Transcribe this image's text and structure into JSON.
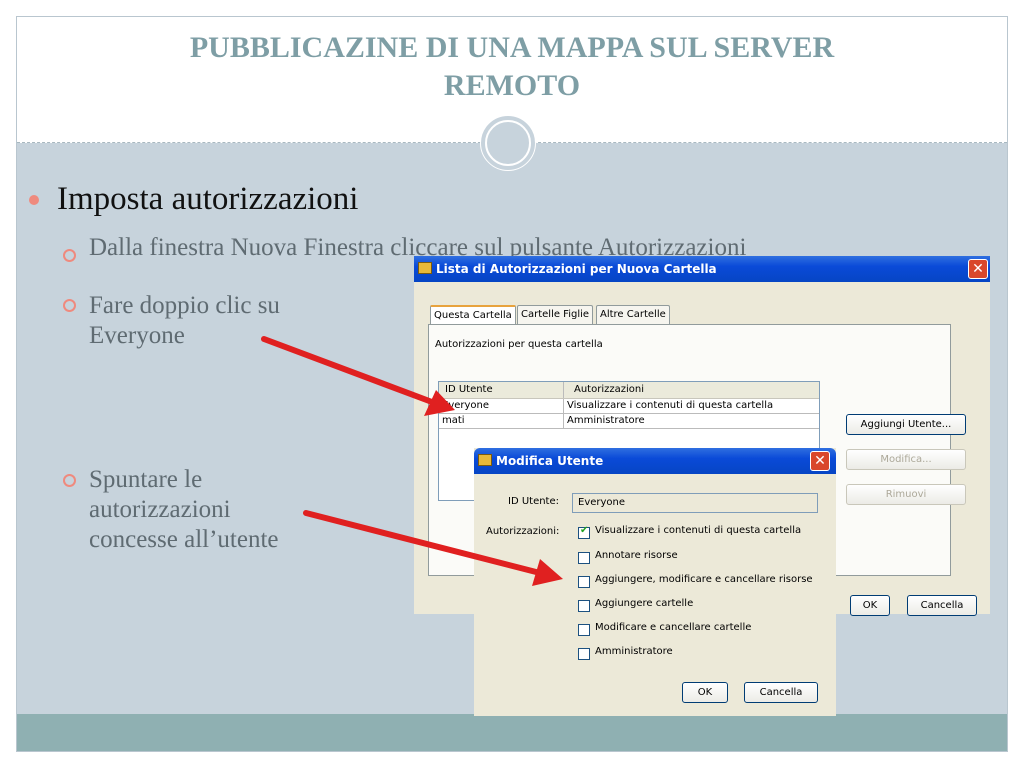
{
  "slide": {
    "title_line1": "PUBBLICAZINE DI UNA MAPPA  SUL SERVER",
    "title_line2": "REMOTO",
    "bullet_main": "Imposta autorizzazioni",
    "sub1": "Dalla finestra Nuova Finestra cliccare sul pulsante Autorizzazioni",
    "sub2_line1": "Fare doppio clic su",
    "sub2_line2": "Everyone",
    "sub3_line1": "Spuntare le",
    "sub3_line2": "autorizzazioni",
    "sub3_line3": "concesse  all’utente",
    "accent_color": "#ef8a7e",
    "title_color": "#7e9ea5"
  },
  "main_dialog": {
    "title": "Lista di Autorizzazioni per Nuova Cartella",
    "close_label": "✕",
    "tabs": [
      "Questa Cartella",
      "Cartelle Figlie",
      "Altre Cartelle"
    ],
    "section_label": "Autorizzazioni per questa cartella",
    "columns": [
      "ID Utente",
      "Autorizzazioni"
    ],
    "rows": [
      {
        "user": "Everyone",
        "perm": "Visualizzare i contenuti di questa cartella"
      },
      {
        "user": "mati",
        "perm": "Amministratore"
      }
    ],
    "add_user": "Aggiungi Utente...",
    "modify": "Modifica...",
    "remove": "Rimuovi",
    "ok": "OK",
    "cancel": "Cancella"
  },
  "edit_dialog": {
    "title": "Modifica Utente",
    "close_label": "✕",
    "id_label": "ID Utente:",
    "id_value": "Everyone",
    "perm_label": "Autorizzazioni:",
    "permissions": [
      {
        "label": "Visualizzare i contenuti di questa cartella",
        "checked": true
      },
      {
        "label": "Annotare risorse",
        "checked": false
      },
      {
        "label": "Aggiungere, modificare e cancellare risorse",
        "checked": false
      },
      {
        "label": "Aggiungere cartelle",
        "checked": false
      },
      {
        "label": "Modificare e cancellare cartelle",
        "checked": false
      },
      {
        "label": "Amministratore",
        "checked": false
      }
    ],
    "ok": "OK",
    "cancel": "Cancella"
  }
}
